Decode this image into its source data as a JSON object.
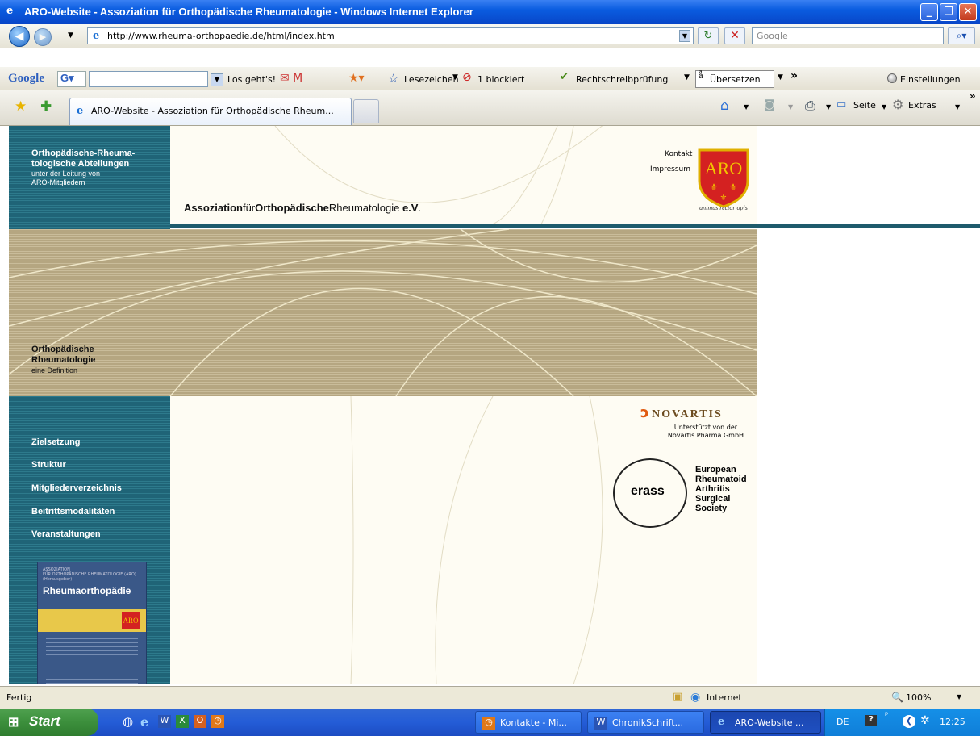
{
  "window": {
    "title": "ARO-Website - Assoziation für Orthopädische Rheumatologie - Windows Internet Explorer"
  },
  "address": {
    "url": "http://www.rheuma-orthopaedie.de/html/index.htm",
    "search_placeholder": "Google"
  },
  "googlebar": {
    "logo": "Google",
    "go_label": "Los geht's!",
    "bookmarks": "Lesezeichen",
    "blocked": "1 blockiert",
    "spellcheck": "Rechtschreibprüfung",
    "translate": "Übersetzen",
    "settings": "Einstellungen"
  },
  "tabs": {
    "active_title": "ARO-Website - Assoziation für Orthopädische Rheum...",
    "page_menu": "Seite",
    "tools_menu": "Extras"
  },
  "site": {
    "sidebar_title_1": "Orthopädische-Rheuma-",
    "sidebar_title_2": "tologische Abteilungen",
    "sidebar_sub_1": "unter der Leitung von",
    "sidebar_sub_2": "ARO-Mitgliedern",
    "org_assoz": "Assoziation",
    "org_fuer": "für",
    "org_ortho": "Orthopädische",
    "org_rheuma": "Rheumatologie ",
    "org_ev": "e.V",
    "org_dot": ".",
    "contact": "Kontakt",
    "imprint": "Impressum",
    "logo_text": "ARO",
    "logo_motto": "animus rector opis",
    "band_title_1": "Orthopädische",
    "band_title_2": "Rheumatologie",
    "band_sub": "eine Definition",
    "nav": [
      "Zielsetzung",
      "Struktur",
      "Mitgliederverzeichnis",
      "Beitrittsmodalitäten",
      "Veranstaltungen"
    ],
    "novartis": "NOVARTIS",
    "novartis_sub_1": "Unterstützt von der",
    "novartis_sub_2": "Novartis Pharma GmbH",
    "erass_logo": "erass",
    "erass_lines": [
      "European",
      "Rheumatoid",
      "Arthritis",
      "Surgical",
      "Society"
    ],
    "book_header_1": "ASSOZIATION",
    "book_header_2": "FÜR ORTHOPÄDISCHE RHEUMATOLOGIE (ARO)",
    "book_header_3": "(Herausgeber)",
    "book_title": "Rheumaorthopädie",
    "book_logo": "ARO"
  },
  "status": {
    "text": "Fertig",
    "zone": "Internet",
    "zoom": "100%"
  },
  "taskbar": {
    "start": "Start",
    "items": [
      "Kontakte - Mi...",
      "ChronikSchrift...",
      "ARO-Website ..."
    ],
    "lang": "DE",
    "clock": "12:25"
  },
  "colors": {
    "teal": "#1f6477",
    "khaki": "#b5a681",
    "cream": "#fefcf3",
    "aro_red": "#d42121",
    "xp_blue": "#245dd7"
  }
}
